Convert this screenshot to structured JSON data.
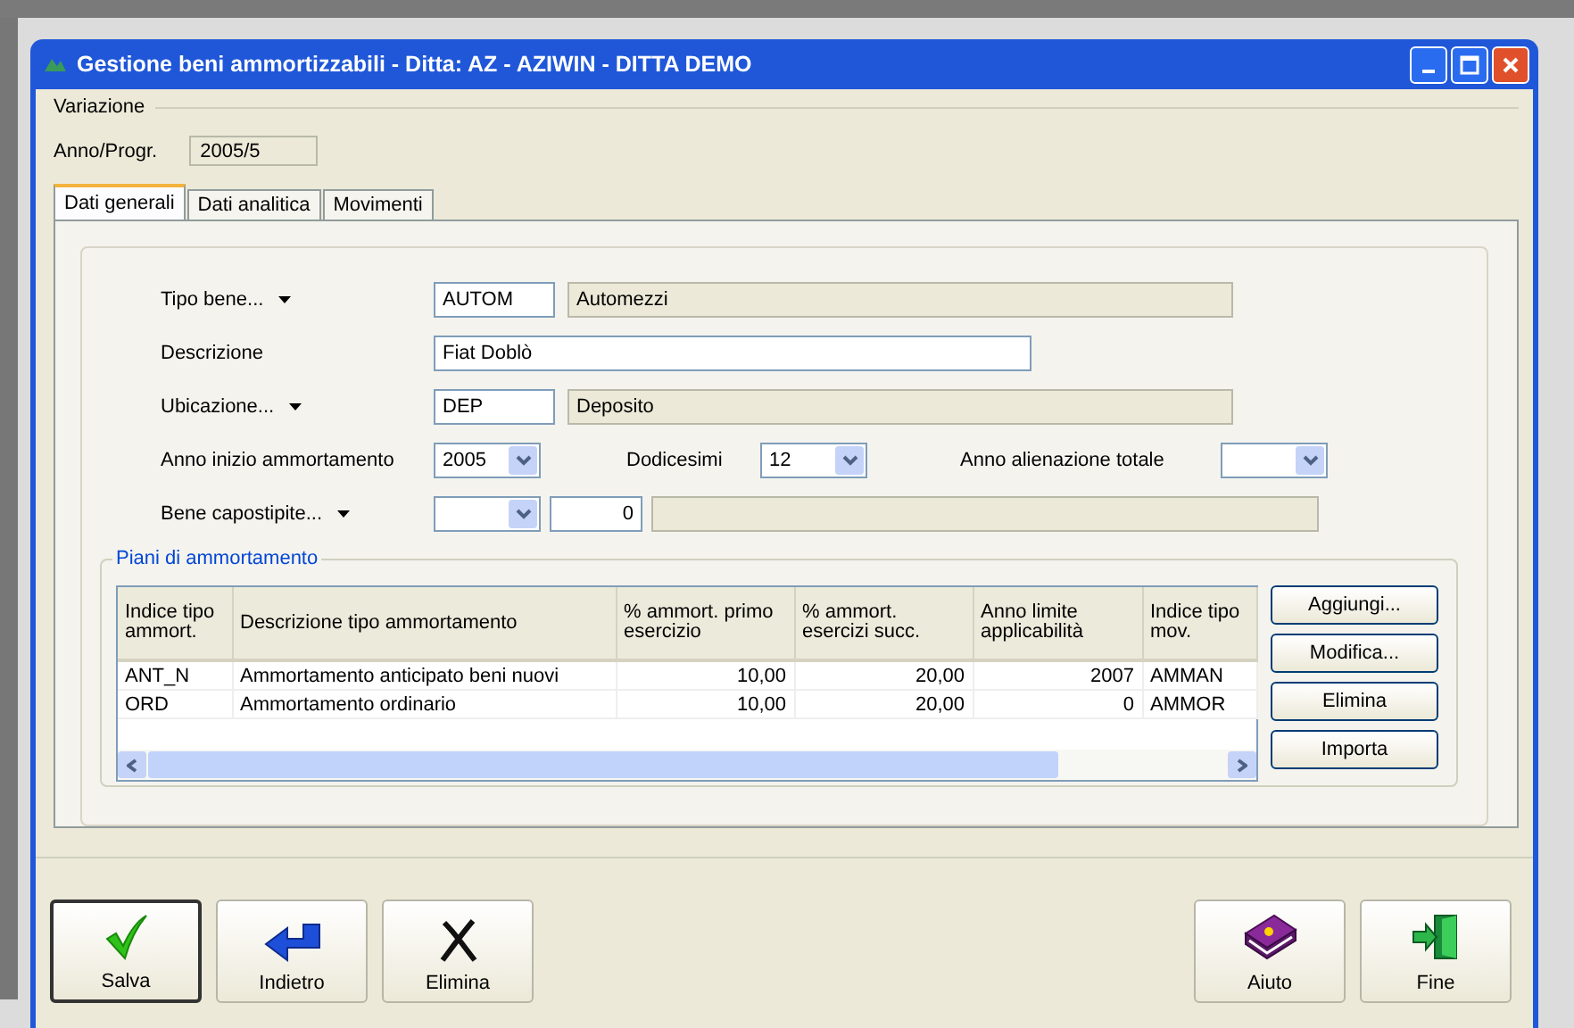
{
  "window": {
    "title": "Gestione beni ammortizzabili - Ditta: AZ - AZIWIN - DITTA DEMO"
  },
  "header": {
    "group_label": "Variazione",
    "anno_label": "Anno/Progr.",
    "anno_value": "2005/5"
  },
  "tabs": [
    {
      "label": "Dati generali",
      "selected": true
    },
    {
      "label": "Dati analitica",
      "selected": false
    },
    {
      "label": "Movimenti",
      "selected": false
    }
  ],
  "form": {
    "tipo_bene": {
      "label": "Tipo bene...",
      "code": "AUTOM",
      "description": "Automezzi"
    },
    "descrizione": {
      "label": "Descrizione",
      "value": "Fiat Doblò"
    },
    "ubicazione": {
      "label": "Ubicazione...",
      "code": "DEP",
      "description": "Deposito"
    },
    "anno_inizio": {
      "label": "Anno inizio ammortamento",
      "value": "2005"
    },
    "dodicesimi": {
      "label": "Dodicesimi",
      "value": "12"
    },
    "anno_alienazione": {
      "label": "Anno alienazione totale"
    },
    "bene_capostipite": {
      "label": "Bene capostipite...",
      "number": "0"
    }
  },
  "piani": {
    "group_label": "Piani di ammortamento",
    "columns": [
      "Indice tipo ammort.",
      "Descrizione tipo ammortamento",
      "% ammort. primo esercizio",
      "% ammort. esercizi succ.",
      "Anno limite applicabilità",
      "Indice tipo mov."
    ],
    "rows": [
      [
        "ANT_N",
        "Ammortamento anticipato beni nuovi",
        "10,00",
        "20,00",
        "2007",
        "AMMAN"
      ],
      [
        "ORD",
        "Ammortamento ordinario",
        "10,00",
        "20,00",
        "0",
        "AMMOR"
      ]
    ],
    "buttons": [
      "Aggiungi...",
      "Modifica...",
      "Elimina",
      "Importa"
    ]
  },
  "toolbar": [
    {
      "label": "Salva",
      "kind": "check",
      "default": true
    },
    {
      "label": "Indietro",
      "kind": "back",
      "default": false
    },
    {
      "label": "Elimina",
      "kind": "cross",
      "default": false
    },
    {
      "label": "Aiuto",
      "kind": "book",
      "default": false
    },
    {
      "label": "Fine",
      "kind": "exit",
      "default": false
    }
  ]
}
